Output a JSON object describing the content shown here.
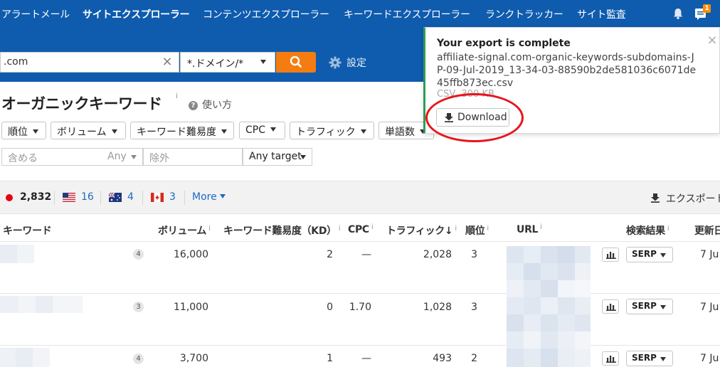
{
  "nav": {
    "items": [
      {
        "label": "アラートメール",
        "active": false
      },
      {
        "label": "サイトエクスプローラー",
        "active": true
      },
      {
        "label": "コンテンツエクスプローラー",
        "active": false
      },
      {
        "label": "キーワードエクスプローラー",
        "active": false
      },
      {
        "label": "ランクトラッカー",
        "active": false
      },
      {
        "label": "サイト監査",
        "active": false
      }
    ],
    "notification_count": "1"
  },
  "search": {
    "target_value": ".com",
    "mode": "*.ドメイン/*",
    "settings_label": "設定"
  },
  "page": {
    "title": "オーガニックキーワード",
    "title_info": "i",
    "howto_label": "使い方"
  },
  "filters": {
    "position": "順位",
    "volume": "ボリューム",
    "kd": "キーワード難易度",
    "cpc": "CPC",
    "traffic": "トラフィック",
    "word_count": "単語数",
    "include_placeholder": "含める",
    "include_scope": "Any",
    "exclude_placeholder": "除外",
    "target_scope": "Any target"
  },
  "countries": [
    {
      "flag": "JP",
      "count": "2,832"
    },
    {
      "flag": "US",
      "count": "16"
    },
    {
      "flag": "AU",
      "count": "4"
    },
    {
      "flag": "CA",
      "count": "3"
    }
  ],
  "more_label": "More",
  "export_label": "エクスポート",
  "table": {
    "headers": {
      "keyword": "キーワード",
      "volume": "ボリューム",
      "kd": "キーワード難易度（KD）",
      "cpc": "CPC",
      "traffic": "トラフィック↓",
      "position": "順位",
      "url": "URL",
      "serp": "検索結果",
      "updated": "更新日"
    },
    "info_mark": "i",
    "rows": [
      {
        "badge": "4",
        "volume": "16,000",
        "kd": "2",
        "cpc": "—",
        "traffic": "2,028",
        "position": "3",
        "serp": "SERP",
        "updated": "7 Ju"
      },
      {
        "badge": "3",
        "volume": "11,000",
        "kd": "0",
        "cpc": "1.70",
        "traffic": "1,028",
        "position": "3",
        "serp": "SERP",
        "updated": "7 Ju"
      },
      {
        "badge": "4",
        "volume": "3,700",
        "kd": "1",
        "cpc": "—",
        "traffic": "493",
        "position": "2",
        "serp": "SERP",
        "updated": "7 Ju"
      }
    ]
  },
  "export_popup": {
    "title": "Your export is complete",
    "filename": "affiliate-signal.com-organic-keywords-subdomains-JP-09-Jul-2019_13-34-03-88590b2de581036c6071de45ffb873ec.csv",
    "size": "CSV, 300 KB",
    "download_label": "Download"
  },
  "colors": {
    "nav_bg": "#0f5cae",
    "search_button": "#f57c10",
    "link": "#1a6bc4",
    "popup_accent": "#2e9c57",
    "annotation_red": "#e8141b"
  }
}
